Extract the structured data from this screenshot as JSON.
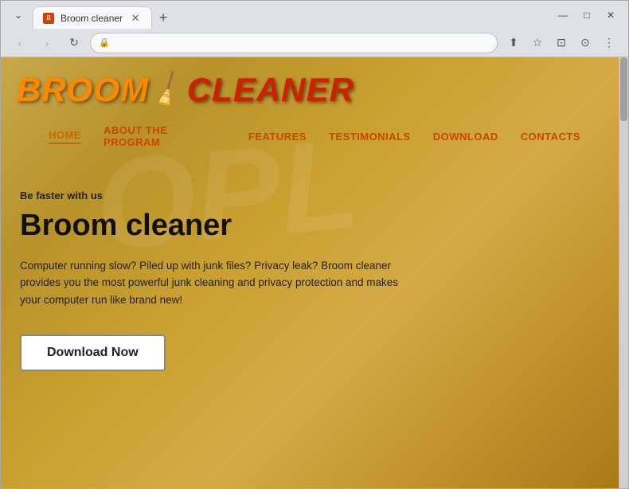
{
  "browser": {
    "tab_title": "Broom cleaner",
    "tab_favicon_label": "B",
    "url": "",
    "nav": {
      "back_label": "‹",
      "forward_label": "›",
      "reload_label": "↻"
    },
    "window_controls": {
      "minimize": "—",
      "maximize": "□",
      "close": "✕"
    },
    "chevron_label": "⌄",
    "new_tab_label": "+",
    "addr_share": "⬆",
    "addr_star": "☆",
    "addr_split": "⊡",
    "addr_profile": "⊙",
    "addr_menu": "⋮"
  },
  "site": {
    "logo": {
      "broom_text": "BROOM",
      "cleaner_text": "CLEANER",
      "broom_icon": "🧹"
    },
    "nav_items": [
      {
        "label": "HOME",
        "active": true
      },
      {
        "label": "ABOUT THE PROGRAM",
        "active": false
      },
      {
        "label": "FEATURES",
        "active": false
      },
      {
        "label": "TESTIMONIALS",
        "active": false
      },
      {
        "label": "DOWNLOAD",
        "active": false
      },
      {
        "label": "CONTACTS",
        "active": false
      }
    ],
    "hero": {
      "tagline": "Be faster with us",
      "title": "Broom cleaner",
      "description": "Computer running slow? Piled up with junk files? Privacy leak? Broom cleaner provides you the most powerful junk cleaning and privacy protection and makes your computer run like brand new!",
      "download_btn": "Download Now"
    },
    "watermark": "OPL"
  }
}
